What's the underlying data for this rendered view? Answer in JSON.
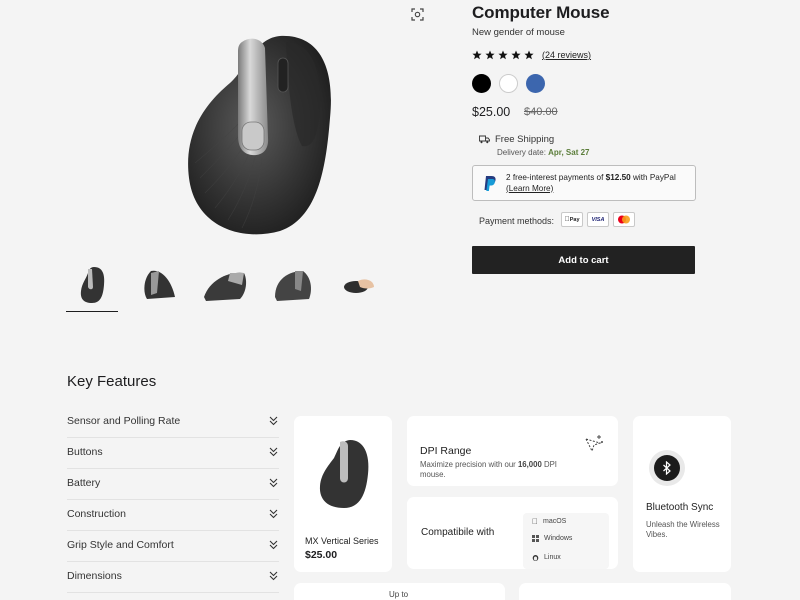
{
  "product": {
    "title": "Computer Mouse",
    "subtitle": "New gender of mouse",
    "reviews_label": "(24 reviews)",
    "rating": 5,
    "colors": [
      "#000000",
      "#ffffff",
      "#3c66ae"
    ],
    "price": "$25.00",
    "old_price": "$40.00"
  },
  "shipping": {
    "label": "Free Shipping",
    "delivery_prefix": "Delivery date: ",
    "delivery_date": "Apr, Sat 27"
  },
  "paypal": {
    "line1_prefix": "2 free-interest payments of ",
    "amount": "$12.50",
    "line1_suffix": " with PayPal",
    "learn_more": "(Learn More)"
  },
  "payment": {
    "label": "Payment methods:",
    "methods": [
      "Apple Pay",
      "VISA",
      "Mastercard"
    ],
    "applepay_text": "Pay",
    "visa_text": "VISA"
  },
  "cart": {
    "add_label": "Add to cart"
  },
  "gallery": {
    "thumb_count": 5,
    "active_index": 0
  },
  "features": {
    "title": "Key Features",
    "accordion": [
      "Sensor and Polling Rate",
      "Buttons",
      "Battery",
      "Construction",
      "Grip Style and Comfort",
      "Dimensions"
    ],
    "series_card": {
      "name": "MX Vertical Series",
      "price": "$25.00"
    },
    "dpi_card": {
      "title": "DPI Range",
      "desc_prefix": "Maximize precision with our ",
      "desc_value": "16,000",
      "desc_suffix": " DPI mouse."
    },
    "compat_card": {
      "title": "Compatibile with",
      "os": [
        "macOS",
        "Windows",
        "Linux"
      ]
    },
    "bt_card": {
      "title": "Bluetooth Sync",
      "desc": "Unleash the Wireless Vibes."
    },
    "upto_card": {
      "label": "Up to"
    }
  }
}
